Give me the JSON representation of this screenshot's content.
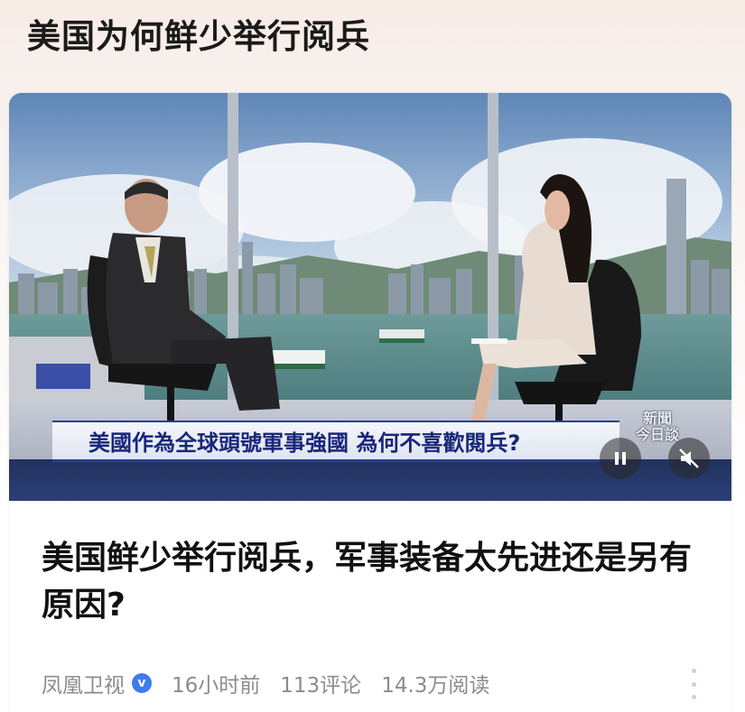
{
  "page": {
    "title": "美国为何鲜少举行阅兵"
  },
  "video": {
    "caption": "美國作為全球頭號軍事強國 為何不喜歡閱兵?",
    "channel_logo_line1": "新聞",
    "channel_logo_line2": "今日談",
    "controls": {
      "pause_icon": "pause-icon",
      "mute_icon": "mute-icon"
    }
  },
  "article": {
    "headline": "美国鲜少举行阅兵，军事装备太先进还是另有原因?",
    "source": "凤凰卫视",
    "verified_mark": "v",
    "time": "16小时前",
    "comments": "113评论",
    "reads": "14.3万阅读"
  },
  "colors": {
    "caption_text": "#18267a",
    "caption_band": "#2d3f78",
    "verified": "#3d7bf0",
    "meta_text": "#8c8c8c"
  }
}
